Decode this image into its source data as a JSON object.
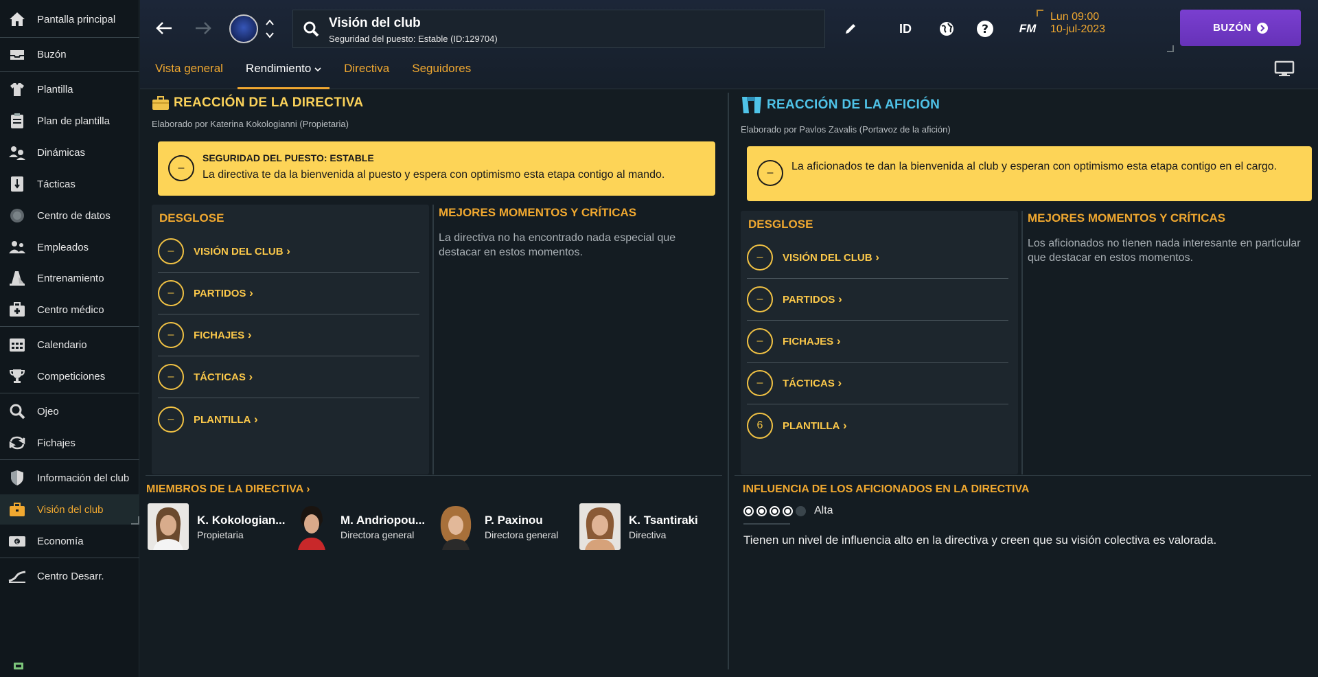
{
  "sidebar": {
    "items": [
      {
        "label": "Pantalla principal",
        "icon": "home-icon"
      },
      {
        "label": "Buzón",
        "icon": "inbox-icon"
      },
      {
        "label": "Plantilla",
        "icon": "shirt-icon"
      },
      {
        "label": "Plan de plantilla",
        "icon": "clipboard-icon"
      },
      {
        "label": "Dinámicas",
        "icon": "people-dynamics-icon"
      },
      {
        "label": "Tácticas",
        "icon": "tactics-board-icon"
      },
      {
        "label": "Centro de datos",
        "icon": "data-hub-icon"
      },
      {
        "label": "Empleados",
        "icon": "staff-icon"
      },
      {
        "label": "Entrenamiento",
        "icon": "training-cone-icon"
      },
      {
        "label": "Centro médico",
        "icon": "medical-kit-icon"
      },
      {
        "label": "Calendario",
        "icon": "calendar-icon"
      },
      {
        "label": "Competiciones",
        "icon": "trophy-icon"
      },
      {
        "label": "Ojeo",
        "icon": "magnifier-icon"
      },
      {
        "label": "Fichajes",
        "icon": "transfer-arrows-icon"
      },
      {
        "label": "Información del club",
        "icon": "shield-icon"
      },
      {
        "label": "Visión del club",
        "icon": "briefcase-icon"
      },
      {
        "label": "Economía",
        "icon": "money-icon"
      },
      {
        "label": "Centro Desarr.",
        "icon": "growth-chart-icon"
      }
    ]
  },
  "topbar": {
    "title": "Visión del club",
    "subtitle": "Seguridad del puesto: Estable (ID:129704)",
    "id_label": "ID",
    "fm_label": "FM",
    "date_line1": "Lun 09:00",
    "date_line2": "10-jul-2023",
    "inbox_label": "BUZÓN",
    "tabs": [
      "Vista general",
      "Rendimiento",
      "Directiva",
      "Seguidores"
    ]
  },
  "board": {
    "title": "REACCIÓN DE LA DIRECTIVA",
    "author": "Elaborado por Katerina Kokologianni (Propietaria)",
    "alert_heading": "SEGURIDAD DEL PUESTO: ESTABLE",
    "alert_text": "La directiva te da la bienvenida al puesto y espera con optimismo esta etapa contigo al mando.",
    "alert_icon": "–",
    "breakdown_title": "DESGLOSE",
    "breakdown": [
      {
        "label": "VISIÓN DEL CLUB",
        "value": "–"
      },
      {
        "label": "PARTIDOS",
        "value": "–"
      },
      {
        "label": "FICHAJES",
        "value": "–"
      },
      {
        "label": "TÁCTICAS",
        "value": "–"
      },
      {
        "label": "PLANTILLA",
        "value": "–"
      }
    ],
    "moments_title": "MEJORES MOMENTOS Y CRÍTICAS",
    "moments_text": "La directiva no ha encontrado nada especial que destacar en estos momentos."
  },
  "fans": {
    "title": "REACCIÓN DE LA AFICIÓN",
    "author": "Elaborado por Pavlos Zavalis (Portavoz de la afición)",
    "alert_text": "La aficionados te dan la bienvenida al club y esperan con optimismo esta etapa contigo en el cargo.",
    "alert_icon": "–",
    "breakdown_title": "DESGLOSE",
    "breakdown": [
      {
        "label": "VISIÓN DEL CLUB",
        "value": "–"
      },
      {
        "label": "PARTIDOS",
        "value": "–"
      },
      {
        "label": "FICHAJES",
        "value": "–"
      },
      {
        "label": "TÁCTICAS",
        "value": "–"
      },
      {
        "label": "PLANTILLA",
        "value": "6"
      }
    ],
    "moments_title": "MEJORES MOMENTOS Y CRÍTICAS",
    "moments_text": "Los aficionados no tienen nada interesante en particular que destacar en estos momentos."
  },
  "members": {
    "title": "MIEMBROS DE LA DIRECTIVA",
    "list": [
      {
        "name": "K. Kokologian...",
        "role": "Propietaria"
      },
      {
        "name": "M. Andriopou...",
        "role": "Directora general"
      },
      {
        "name": "P. Paxinou",
        "role": "Directora general"
      },
      {
        "name": "K. Tsantiraki",
        "role": "Directiva"
      }
    ]
  },
  "influence": {
    "title": "INFLUENCIA DE LOS AFICIONADOS EN LA DIRECTIVA",
    "level_label": "Alta",
    "level_value": 4,
    "level_max": 5,
    "text": "Tienen un nivel de influencia alto en la directiva y creen que su visión colectiva es valorada."
  },
  "colors": {
    "accent": "#f0a830",
    "fan_accent": "#4fc3e8",
    "alert_bg": "#fdd457",
    "inbox_btn": "#7a3fd0",
    "ring": "#f1c244"
  }
}
